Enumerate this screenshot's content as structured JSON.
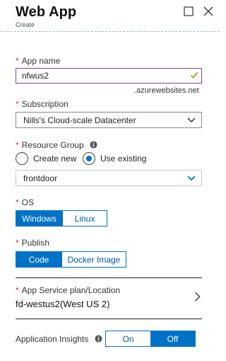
{
  "header": {
    "title": "Web App",
    "subtitle": "Create"
  },
  "app_name": {
    "label": "App name",
    "value": "nfwus2",
    "suffix": ".azurewebsites.net"
  },
  "subscription": {
    "label": "Subscription",
    "value": "Nills's Cloud-scale Datacenter"
  },
  "resource_group": {
    "label": "Resource Group",
    "option_create": "Create new",
    "option_existing": "Use existing",
    "selected_option": "Use existing",
    "value": "frontdoor"
  },
  "os": {
    "label": "OS",
    "options": [
      "Windows",
      "Linux"
    ],
    "selected": "Windows"
  },
  "publish": {
    "label": "Publish",
    "options": [
      "Code",
      "Docker Image"
    ],
    "selected": "Code"
  },
  "service_plan": {
    "label": "App Service plan/Location",
    "value": "fd-westus2(West US 2)"
  },
  "app_insights": {
    "label": "Application Insights",
    "options": [
      "On",
      "Off"
    ],
    "selected": "Off"
  },
  "required_marker": "*",
  "colors": {
    "accent": "#0072c6",
    "required": "#d13438",
    "valid_check": "#7fba00",
    "focus_border": "#8b3e92"
  }
}
